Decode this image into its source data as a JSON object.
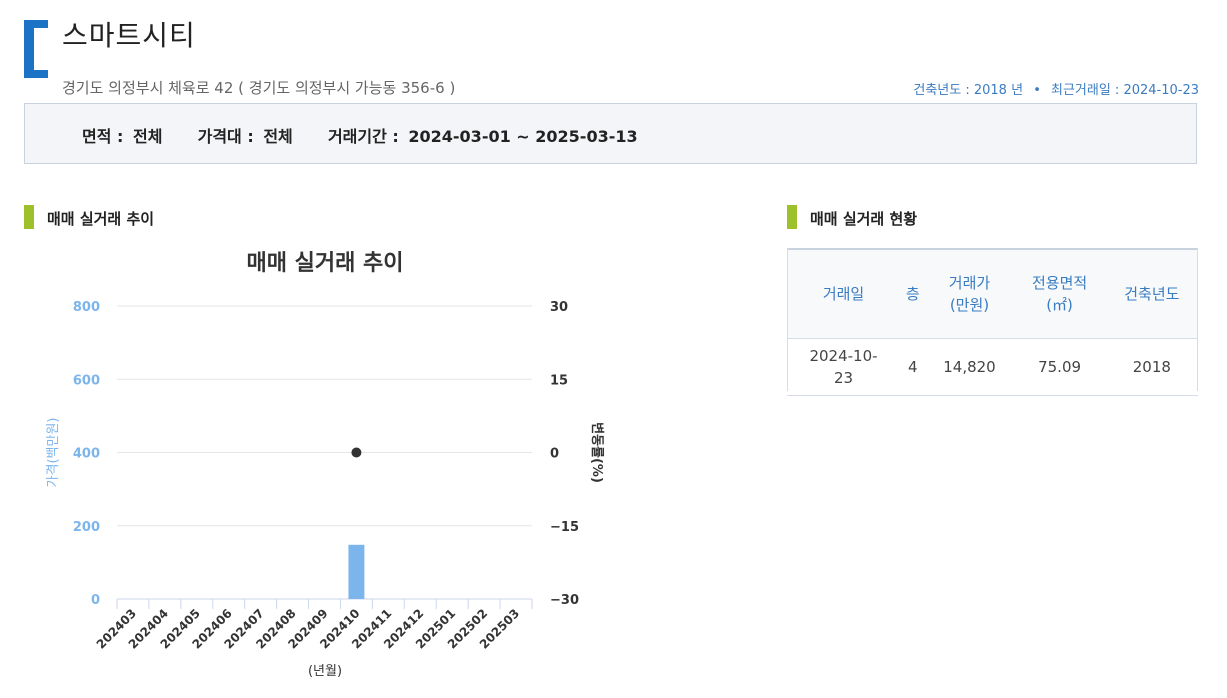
{
  "header": {
    "title": "스마트시티",
    "address": "경기도 의정부시 체육로 42 ( 경기도 의정부시 가능동 356-6 )",
    "built_year_text": "건축년도 : 2018 년",
    "recent_trade_text": "최근거래일 : 2024-10-23",
    "separator": "•"
  },
  "filter": {
    "area_label": "면적 :",
    "area_value": "전체",
    "price_label": "가격대 :",
    "price_value": "전체",
    "period_label": "거래기간 :",
    "period_value": "2024-03-01 ~ 2025-03-13"
  },
  "left_section": {
    "title": "매매 실거래 추이"
  },
  "right_section": {
    "title": "매매 실거래 현황"
  },
  "table": {
    "headers": [
      "거래일",
      "층",
      "거래가\n(만원)",
      "전용면적\n(㎡)",
      "건축년도"
    ],
    "rows": [
      [
        "2024-10-\n23",
        "4",
        "14,820",
        "75.09",
        "2018"
      ]
    ]
  },
  "colors": {
    "accent_blue": "#1a73c4",
    "accent_green": "#9dc02b",
    "bar_blue": "#7cb5ec",
    "axis_left": "#7cb5ec",
    "point": "#333333"
  },
  "chart_data": {
    "type": "bar",
    "title": "매매 실거래 추이",
    "xlabel": "(년월)",
    "ylabel": "가격(백만원)",
    "y2label": "변동률(%)",
    "categories": [
      "202403",
      "202404",
      "202405",
      "202406",
      "202407",
      "202408",
      "202409",
      "202410",
      "202411",
      "202412",
      "202501",
      "202502",
      "202503"
    ],
    "ylim": [
      0,
      800
    ],
    "yticks": [
      0,
      200,
      400,
      600,
      800
    ],
    "y2lim": [
      -30,
      30
    ],
    "y2ticks": [
      -30,
      -15,
      0,
      15,
      30
    ],
    "series": [
      {
        "type": "bar",
        "axis": "left",
        "values": [
          null,
          null,
          null,
          null,
          null,
          null,
          null,
          148,
          null,
          null,
          null,
          null,
          null
        ]
      },
      {
        "type": "scatter",
        "axis": "right",
        "values": [
          null,
          null,
          null,
          null,
          null,
          null,
          null,
          0,
          null,
          null,
          null,
          null,
          null
        ]
      }
    ],
    "grid": true
  }
}
